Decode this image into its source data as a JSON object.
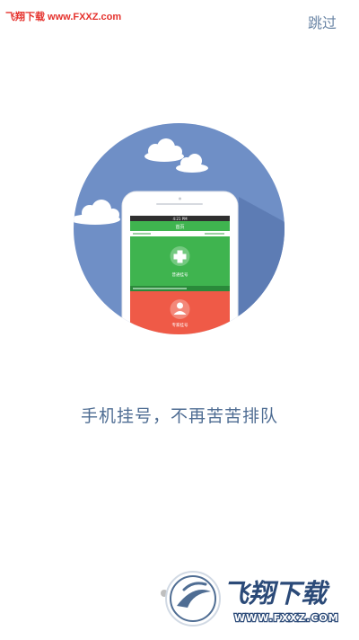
{
  "watermark_top": "飞翔下载 www.FXXZ.com",
  "skip_label": "跳过",
  "slogan": "手机挂号，不再苦苦排队",
  "phone_screen": {
    "status_time": "4:21 PM",
    "nav_title": "首页",
    "green_label": "普通挂号",
    "red_label": "专家挂号"
  },
  "watermark_bottom": {
    "title": "飞翔下载",
    "url": "WWW.FXXZ.COM"
  },
  "colors": {
    "circle": "#6f8fc6",
    "green": "#3fb44f",
    "red": "#ef5a47",
    "slogan": "#4f6d93",
    "skip": "#6b86a6"
  }
}
